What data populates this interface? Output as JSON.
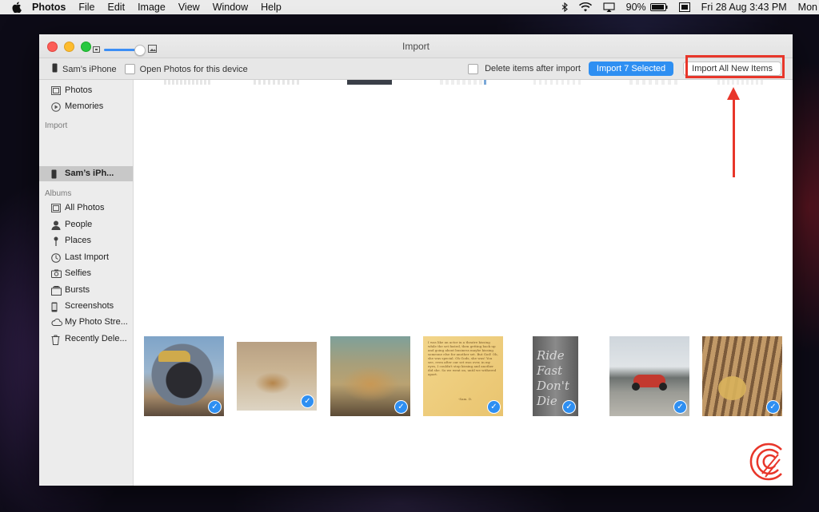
{
  "menubar": {
    "app_name": "Photos",
    "menus": [
      "File",
      "Edit",
      "Image",
      "View",
      "Window",
      "Help"
    ],
    "battery": "90%",
    "datetime": "Fri 28 Aug  3:43 PM",
    "user": "Mon"
  },
  "window": {
    "title": "Import"
  },
  "toolbar": {
    "device_name": "Sam’s iPhone",
    "open_photos_label": "Open Photos for this device",
    "delete_after_label": "Delete items after import",
    "import_selected_label": "Import 7 Selected",
    "import_all_label": "Import All New Items"
  },
  "sidebar": {
    "top_items": [
      {
        "label": "Photos",
        "icon": "photos-icon"
      },
      {
        "label": "Memories",
        "icon": "memories-icon"
      }
    ],
    "import_header": "Import",
    "import_device": "Sam’s iPh...",
    "albums_header": "Albums",
    "albums": [
      {
        "label": "All Photos",
        "icon": "all-photos-icon"
      },
      {
        "label": "People",
        "icon": "people-icon"
      },
      {
        "label": "Places",
        "icon": "places-icon"
      },
      {
        "label": "Last Import",
        "icon": "clock-icon"
      },
      {
        "label": "Selfies",
        "icon": "selfies-icon"
      },
      {
        "label": "Bursts",
        "icon": "bursts-icon"
      },
      {
        "label": "Screenshots",
        "icon": "screenshots-icon"
      },
      {
        "label": "My Photo Stre...",
        "icon": "cloud-icon"
      },
      {
        "label": "Recently Dele...",
        "icon": "trash-icon"
      }
    ]
  },
  "thumbnails": [
    {
      "subject": "helmet-selfie",
      "selected": true
    },
    {
      "subject": "dog-lying",
      "selected": true
    },
    {
      "subject": "dog-closeup",
      "selected": true
    },
    {
      "subject": "text-note",
      "selected": true,
      "text": "I was like an actor in a theatre kissing while the set fasted, then getting back up and going about business maybe kissing someone else for another set. But God! Oh, she was special. Oh Gods, she was! You see, even after our set was over, in my eyes, I couldn't stop kissing and another did she. So we went on, until we withered apart.",
      "signature": "-Sam. D."
    },
    {
      "subject": "ride-fast-sign",
      "selected": true,
      "text": "Ride Fast Don't Die"
    },
    {
      "subject": "motorcycle-mountains",
      "selected": true
    },
    {
      "subject": "dog-balcony",
      "selected": true
    }
  ]
}
